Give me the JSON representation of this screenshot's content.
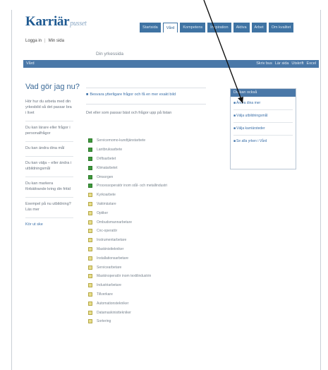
{
  "brand": {
    "name": "Karriär",
    "suffix": "pusset"
  },
  "topnav": [
    {
      "label": "Startsida",
      "active": false
    },
    {
      "label": "Vård",
      "active": true
    },
    {
      "label": "Kompetens",
      "active": false
    },
    {
      "label": "Inspiration",
      "active": false
    },
    {
      "label": "Aktiva",
      "active": false
    },
    {
      "label": "Arbet",
      "active": false
    },
    {
      "label": "Om kvalitet",
      "active": false
    }
  ],
  "subnav": {
    "login": "Logga in",
    "sep": "|",
    "mine": "Min sida"
  },
  "page_title": "Din yrkessida",
  "bluebar": {
    "left": "Vård",
    "right": [
      "Skriv bus",
      "Lär sida",
      "Utskrift",
      "Excel"
    ]
  },
  "heading": "Vad gör jag nu?",
  "left_items": [
    "Hör hur du arbeta med din yrkesbild så det passar bra i livet",
    "Du kan lärare eller frågor i personalfrågor",
    "Du kan ändra dina mål",
    "Du kan välja – eller ändra i utbildningsmål",
    "Du kan markera förbättrande kring din fritid",
    "Exempel på nu utbildning? Läs mer",
    "Kör ut ske"
  ],
  "left_link": "Läs mer",
  "left_link_bottom": "Kör ut ske",
  "intro_link": "Besvara ytterligare frågor och få en mer exakt bild",
  "lead": "Det eller som passar bäst och frågor upp på listan",
  "list": [
    {
      "label": "Servicemomo-kundtjänstarbete",
      "checked": true
    },
    {
      "label": "Lantbruksarbete",
      "checked": true
    },
    {
      "label": "Driftsarbetet",
      "checked": true
    },
    {
      "label": "Klimatarbetet",
      "checked": true
    },
    {
      "label": "Omsorgen",
      "checked": true
    },
    {
      "label": "Processoperatör inom stål- och metallindustri",
      "checked": true
    },
    {
      "label": "Kyrkoarbete",
      "checked": false
    },
    {
      "label": "Vaktmästare",
      "checked": false
    },
    {
      "label": "Optiker",
      "checked": false
    },
    {
      "label": "Ombudsmannarbetare",
      "checked": false
    },
    {
      "label": "Cnc-operatör",
      "checked": false
    },
    {
      "label": "Instrumentarbetare",
      "checked": false
    },
    {
      "label": "Maskinisttekniker",
      "checked": false
    },
    {
      "label": "Installationsarbetare",
      "checked": false
    },
    {
      "label": "Servicearbetare",
      "checked": false
    },
    {
      "label": "Maskinoperatör inom textilindustrin",
      "checked": false
    },
    {
      "label": "Industriarbetare",
      "checked": false
    },
    {
      "label": "Tillverkare",
      "checked": false
    },
    {
      "label": "Automationstekniker",
      "checked": false
    },
    {
      "label": "Datamaskinisttekniker",
      "checked": false
    },
    {
      "label": "Sortering",
      "checked": false
    }
  ],
  "rbox": {
    "title": "Du kan också",
    "links": [
      "Ändra dina mer",
      "Välja utbildningsmål",
      "Välja karriärsteder"
    ],
    "bottom_link": "Se alla yrken i Vård"
  }
}
